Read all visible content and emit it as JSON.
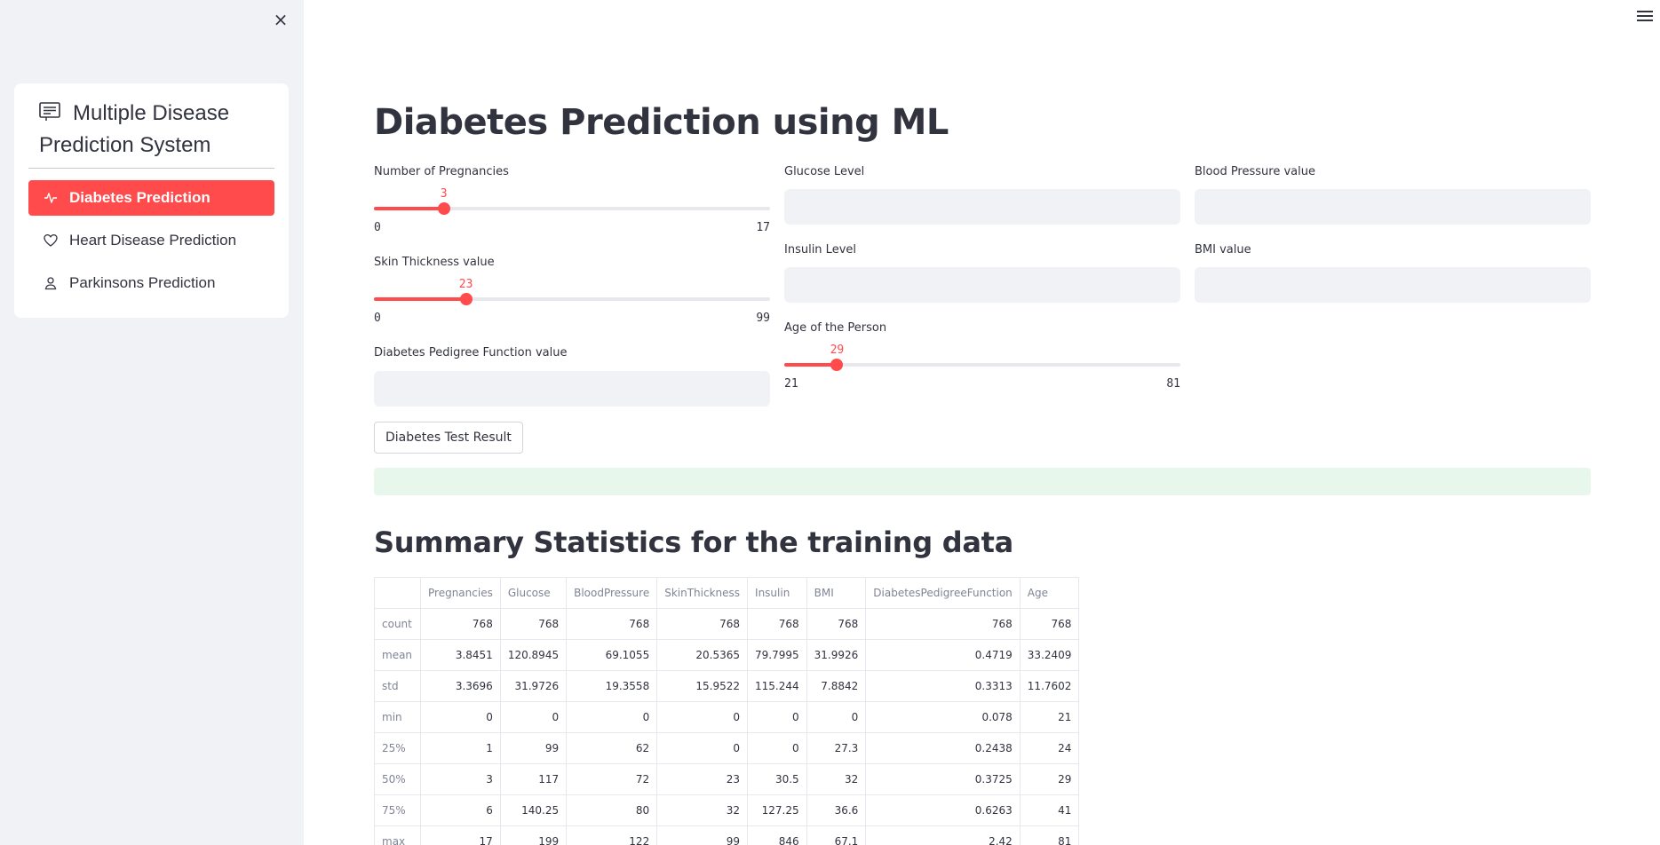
{
  "sidebar": {
    "close_icon": "×",
    "menu_title": "Multiple Disease Prediction System",
    "items": [
      {
        "label": "Diabetes Prediction",
        "icon": "activity-icon",
        "active": true
      },
      {
        "label": "Heart Disease Prediction",
        "icon": "heart-icon",
        "active": false
      },
      {
        "label": "Parkinsons Prediction",
        "icon": "person-icon",
        "active": false
      }
    ]
  },
  "colors": {
    "accent": "#ff4b4b",
    "sidebar_bg": "#f0f2f6",
    "success_bg": "#e8f7ec"
  },
  "main": {
    "title": "Diabetes Prediction using ML",
    "fields": {
      "pregnancies": {
        "label": "Number of Pregnancies",
        "value": "3",
        "min": "0",
        "max": "17",
        "fraction": 0.1765
      },
      "glucose": {
        "label": "Glucose Level",
        "value": ""
      },
      "blood_pressure": {
        "label": "Blood Pressure value",
        "value": ""
      },
      "skin_thickness": {
        "label": "Skin Thickness value",
        "value": "23",
        "min": "0",
        "max": "99",
        "fraction": 0.2323
      },
      "insulin": {
        "label": "Insulin Level",
        "value": ""
      },
      "bmi": {
        "label": "BMI value",
        "value": ""
      },
      "pedigree": {
        "label": "Diabetes Pedigree Function value",
        "value": ""
      },
      "age": {
        "label": "Age of the Person",
        "value": "29",
        "min": "21",
        "max": "81",
        "fraction": 0.1333
      }
    },
    "button_label": "Diabetes Test Result",
    "result_text": "",
    "summary_title": "Summary Statistics for the training data",
    "table": {
      "columns": [
        "",
        "Pregnancies",
        "Glucose",
        "BloodPressure",
        "SkinThickness",
        "Insulin",
        "BMI",
        "DiabetesPedigreeFunction",
        "Age"
      ],
      "rows": [
        [
          "count",
          "768",
          "768",
          "768",
          "768",
          "768",
          "768",
          "768",
          "768"
        ],
        [
          "mean",
          "3.8451",
          "120.8945",
          "69.1055",
          "20.5365",
          "79.7995",
          "31.9926",
          "0.4719",
          "33.2409"
        ],
        [
          "std",
          "3.3696",
          "31.9726",
          "19.3558",
          "15.9522",
          "115.244",
          "7.8842",
          "0.3313",
          "11.7602"
        ],
        [
          "min",
          "0",
          "0",
          "0",
          "0",
          "0",
          "0",
          "0.078",
          "21"
        ],
        [
          "25%",
          "1",
          "99",
          "62",
          "0",
          "0",
          "27.3",
          "0.2438",
          "24"
        ],
        [
          "50%",
          "3",
          "117",
          "72",
          "23",
          "30.5",
          "32",
          "0.3725",
          "29"
        ],
        [
          "75%",
          "6",
          "140.25",
          "80",
          "32",
          "127.25",
          "36.6",
          "0.6263",
          "41"
        ],
        [
          "max",
          "17",
          "199",
          "122",
          "99",
          "846",
          "67.1",
          "2.42",
          "81"
        ]
      ]
    }
  }
}
